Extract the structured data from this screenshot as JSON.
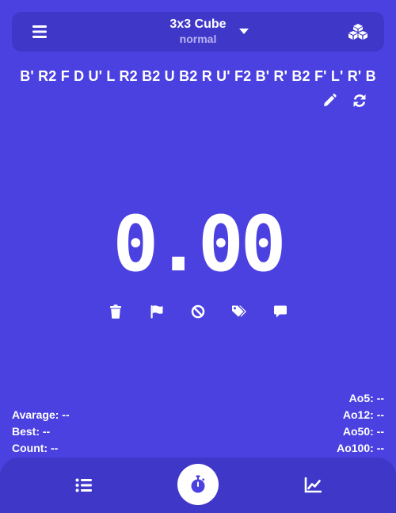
{
  "header": {
    "puzzle": "3x3 Cube",
    "mode": "normal",
    "icons": {
      "menu": "hamburger-menu-icon",
      "dropdown": "caret-down-icon",
      "puzzle_select": "cubes-icon"
    }
  },
  "scramble": "B' R2 F D U' L R2 B2 U B2 R U' F2 B' R' B2 F' L' R' B",
  "scramble_tools": {
    "edit": "pencil-icon",
    "refresh": "refresh-icon"
  },
  "timer": {
    "display": "0.00"
  },
  "actions": [
    "trash-icon",
    "flag-icon",
    "ban-icon",
    "tags-icon",
    "comment-icon"
  ],
  "stats": {
    "average": "Avarage: --",
    "best": "Best: --",
    "count": "Count: --",
    "ao5": "Ao5: --",
    "ao12": "Ao12: --",
    "ao50": "Ao50: --",
    "ao100": "Ao100: --"
  },
  "nav": {
    "items": [
      "list-icon",
      "stopwatch-icon",
      "line-chart-icon"
    ],
    "active": "stopwatch-icon"
  },
  "colors": {
    "background": "#4a41e0",
    "panel": "#3f37c8",
    "text": "#ffffff",
    "muted": "#b9b4f2"
  }
}
